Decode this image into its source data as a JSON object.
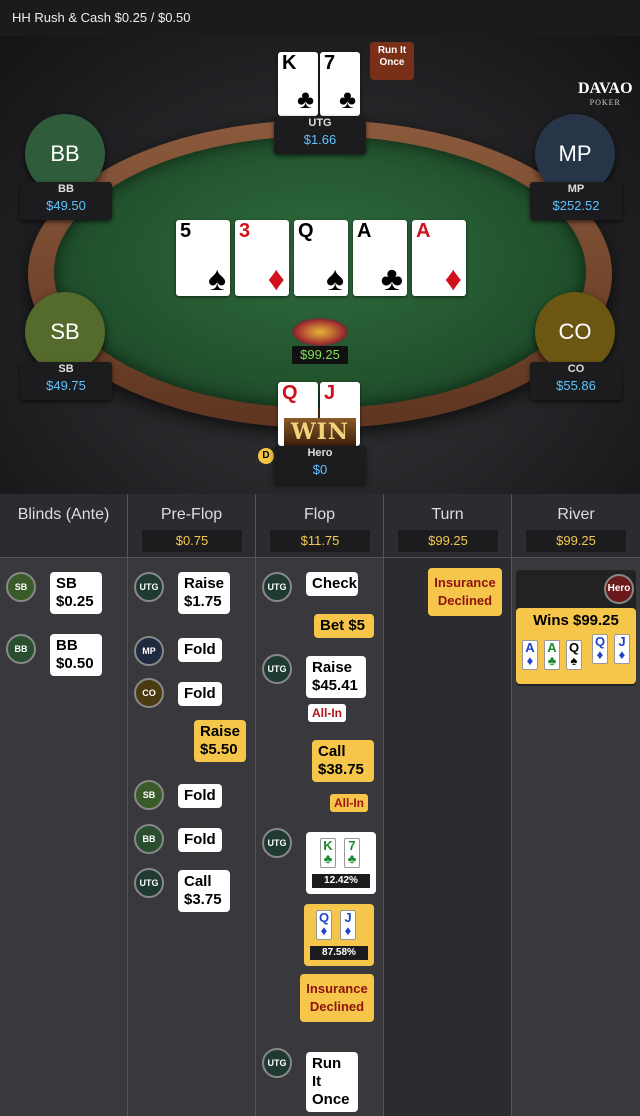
{
  "header": {
    "title": "HH  Rush & Cash $0.25 / $0.50"
  },
  "logo": {
    "main": "DAVAO",
    "sub": "POKER"
  },
  "seats": {
    "bb": {
      "label": "BB",
      "name": "BB",
      "stack": "$49.50",
      "color": "#2f5c3a"
    },
    "mp": {
      "label": "MP",
      "name": "MP",
      "stack": "$252.52",
      "color": "#263548"
    },
    "sb": {
      "label": "SB",
      "name": "SB",
      "stack": "$49.75",
      "color": "#546b2c"
    },
    "co": {
      "label": "CO",
      "name": "CO",
      "stack": "$55.86",
      "color": "#6b5712"
    },
    "utg": {
      "name": "UTG",
      "stack": "$1.66",
      "cards": [
        {
          "rank": "K",
          "suit": "♣"
        },
        {
          "rank": "7",
          "suit": "♣"
        }
      ],
      "bubble": "Run It Once"
    },
    "hero": {
      "name": "Hero",
      "stack": "$0",
      "cards": [
        {
          "rank": "Q",
          "suit": "♦"
        },
        {
          "rank": "J",
          "suit": "♦"
        }
      ],
      "win_text": "WIN"
    }
  },
  "dealer_button": "D",
  "board": [
    {
      "rank": "5",
      "suit": "♠",
      "color": "black"
    },
    {
      "rank": "3",
      "suit": "♦",
      "color": "red"
    },
    {
      "rank": "Q",
      "suit": "♠",
      "color": "black"
    },
    {
      "rank": "A",
      "suit": "♣",
      "color": "black"
    },
    {
      "rank": "A",
      "suit": "♦",
      "color": "red"
    }
  ],
  "pot": "$99.25",
  "columns": [
    {
      "title": "Blinds (Ante)",
      "pot": ""
    },
    {
      "title": "Pre-Flop",
      "pot": "$0.75"
    },
    {
      "title": "Flop",
      "pot": "$11.75"
    },
    {
      "title": "Turn",
      "pot": "$99.25"
    },
    {
      "title": "River",
      "pot": "$99.25"
    }
  ],
  "blinds": [
    {
      "pos": "SB",
      "action": "SB",
      "amount": "$0.25"
    },
    {
      "pos": "BB",
      "action": "BB",
      "amount": "$0.50"
    }
  ],
  "preflop": [
    {
      "pos": "UTG",
      "action": "Raise",
      "amount": "$1.75"
    },
    {
      "pos": "MP",
      "action": "Fold"
    },
    {
      "pos": "CO",
      "action": "Fold"
    },
    {
      "pos": "",
      "action": "Raise",
      "amount": "$5.50"
    },
    {
      "pos": "SB",
      "action": "Fold"
    },
    {
      "pos": "BB",
      "action": "Fold"
    },
    {
      "pos": "UTG",
      "action": "Call",
      "amount": "$3.75"
    }
  ],
  "flop": {
    "utg_check": {
      "pos": "UTG",
      "action": "Check"
    },
    "hero_bet": {
      "action": "Bet  $5"
    },
    "utg_raise": {
      "pos": "UTG",
      "action": "Raise",
      "amount": "$45.41",
      "tag": "All-In"
    },
    "hero_call": {
      "action": "Call",
      "amount": "$38.75",
      "tag": "All-In"
    },
    "utg_equity": {
      "pos": "UTG",
      "cards": [
        "K",
        "7"
      ],
      "suit": "♣",
      "pct": "12.42%"
    },
    "hero_equity": {
      "cards": [
        "Q",
        "J"
      ],
      "suit": "♦",
      "pct": "87.58%"
    },
    "insurance": "Insurance Declined",
    "run_it": {
      "pos": "UTG",
      "text": "Run It Once"
    }
  },
  "turn": {
    "insurance": "Insurance Declined"
  },
  "river": {
    "avatar": "Hero",
    "win": "Wins $99.25",
    "cards": [
      {
        "rank": "A",
        "suit": "♦",
        "color": "blue"
      },
      {
        "rank": "A",
        "suit": "♣",
        "color": "green"
      },
      {
        "rank": "Q",
        "suit": "♠",
        "color": "black"
      },
      {
        "rank": "Q",
        "suit": "♦",
        "color": "blue"
      },
      {
        "rank": "J",
        "suit": "♦",
        "color": "blue"
      }
    ]
  }
}
